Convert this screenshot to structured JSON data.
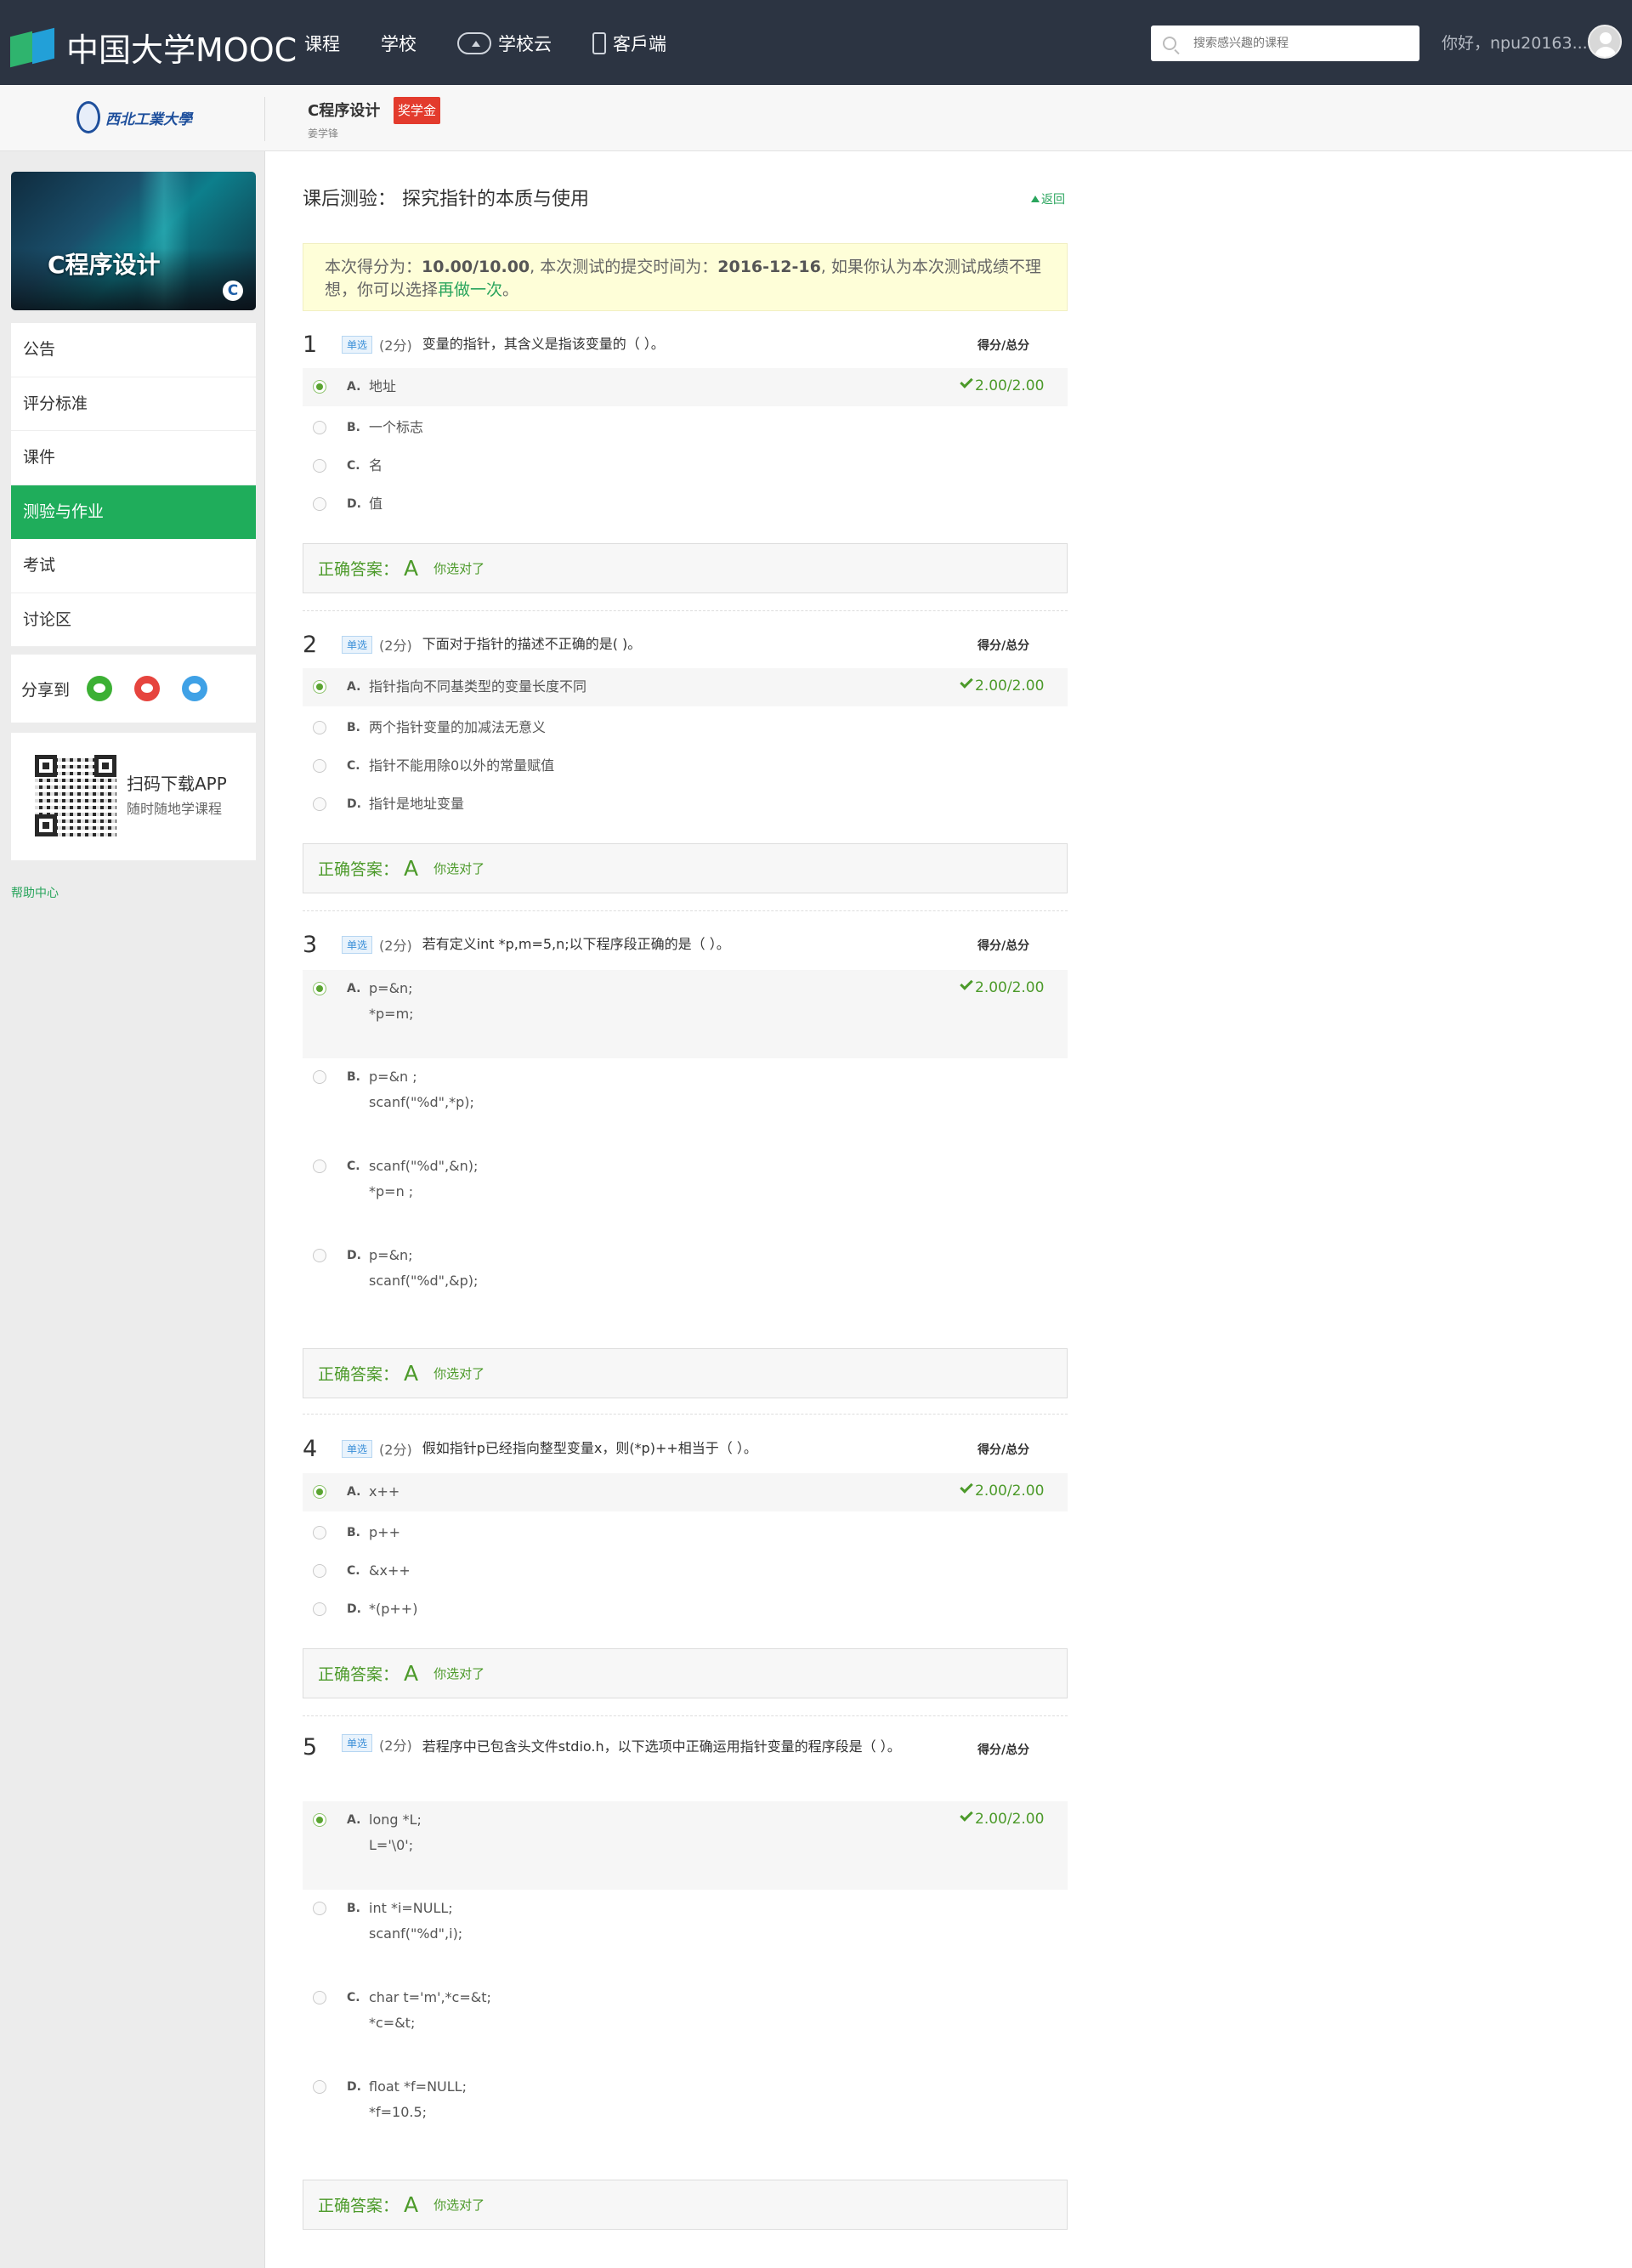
{
  "header": {
    "logo_text": "中国大学MOOC",
    "nav": [
      {
        "label": "课程",
        "icon": ""
      },
      {
        "label": "学校",
        "icon": ""
      },
      {
        "label": "学校云",
        "icon": "cloud-icon"
      },
      {
        "label": "客戶端",
        "icon": "phone-icon"
      }
    ],
    "search_placeholder": "搜索感兴趣的课程",
    "greeting": "你好，npu20163..."
  },
  "course_bar": {
    "school_name": "西北工業大學",
    "course_title": "C程序设计",
    "badge": "奖学金",
    "teacher": "姜学锋"
  },
  "sidebar": {
    "banner_title": "C程序设计",
    "banner_badge": "C",
    "menu": [
      {
        "label": "公告",
        "active": false
      },
      {
        "label": "评分标准",
        "active": false
      },
      {
        "label": "课件",
        "active": false
      },
      {
        "label": "测验与作业",
        "active": true
      },
      {
        "label": "考试",
        "active": false
      },
      {
        "label": "讨论区",
        "active": false
      }
    ],
    "share_label": "分享到",
    "share_icons": [
      "wechat-icon",
      "weibo-icon",
      "qq-icon"
    ],
    "app_title": "扫码下载APP",
    "app_sub": "随时随地学课程",
    "help": "帮助中心"
  },
  "quiz": {
    "title": "课后测验： 探究指针的本质与使用",
    "back": "返回",
    "notice": {
      "prefix": "本次得分为：",
      "score": "10.00/10.00",
      "mid": ", 本次测试的提交时间为：",
      "date": "2016-12-16",
      "suffix": ", 如果你认为本次测试成绩不理想，你可以选择",
      "redo": "再做一次",
      "end": "。"
    },
    "total_header": "得分/总分",
    "answer_label": "正确答案：",
    "answer_note": "你选对了",
    "questions": [
      {
        "num": "1",
        "type": "单选",
        "points": "(2分)",
        "text": "变量的指针，其含义是指该变量的（ ）。",
        "options": [
          {
            "letter": "A.",
            "text": "地址",
            "selected": true,
            "score": "2.00/2.00"
          },
          {
            "letter": "B.",
            "text": "一个标志",
            "selected": false
          },
          {
            "letter": "C.",
            "text": "名",
            "selected": false
          },
          {
            "letter": "D.",
            "text": "值",
            "selected": false
          }
        ],
        "answer": "A"
      },
      {
        "num": "2",
        "type": "单选",
        "points": "(2分)",
        "text": "下面对于指针的描述不正确的是( )。",
        "options": [
          {
            "letter": "A.",
            "text": "指针指向不同基类型的变量长度不同",
            "selected": true,
            "score": "2.00/2.00"
          },
          {
            "letter": "B.",
            "text": "两个指针变量的加减法无意义",
            "selected": false
          },
          {
            "letter": "C.",
            "text": "指针不能用除0以外的常量赋值",
            "selected": false
          },
          {
            "letter": "D.",
            "text": "指针是地址变量",
            "selected": false
          }
        ],
        "answer": "A"
      },
      {
        "num": "3",
        "type": "单选",
        "points": "(2分)",
        "text": "若有定义int *p,m=5,n;以下程序段正确的是（ ）。",
        "options": [
          {
            "letter": "A.",
            "text": "p=&n;\n*p=m;",
            "selected": true,
            "score": "2.00/2.00"
          },
          {
            "letter": "B.",
            "text": "p=&n ;\nscanf(\"%d\",*p);",
            "selected": false
          },
          {
            "letter": "C.",
            "text": "scanf(\"%d\",&n);\n*p=n ;",
            "selected": false
          },
          {
            "letter": "D.",
            "text": "p=&n;\nscanf(\"%d\",&p);",
            "selected": false
          }
        ],
        "answer": "A"
      },
      {
        "num": "4",
        "type": "单选",
        "points": "(2分)",
        "text": "假如指针p已经指向整型变量x，则(*p)++相当于（ ）。",
        "options": [
          {
            "letter": "A.",
            "text": "x++",
            "selected": true,
            "score": "2.00/2.00"
          },
          {
            "letter": "B.",
            "text": "p++",
            "selected": false
          },
          {
            "letter": "C.",
            "text": "&x++",
            "selected": false
          },
          {
            "letter": "D.",
            "text": "*(p++)",
            "selected": false
          }
        ],
        "answer": "A"
      },
      {
        "num": "5",
        "type": "单选",
        "points": "(2分)",
        "text": "若程序中已包含头文件stdio.h，以下选项中正确运用指针变量的程序段是（ ）。",
        "options": [
          {
            "letter": "A.",
            "text": "long *L;\nL='\\0';",
            "selected": true,
            "score": "2.00/2.00"
          },
          {
            "letter": "B.",
            "text": "int *i=NULL;\nscanf(\"%d\",i);",
            "selected": false
          },
          {
            "letter": "C.",
            "text": "char t='m',*c=&t;\n*c=&t;",
            "selected": false
          },
          {
            "letter": "D.",
            "text": "float *f=NULL;\n*f=10.5;",
            "selected": false
          }
        ],
        "answer": "A"
      }
    ]
  }
}
